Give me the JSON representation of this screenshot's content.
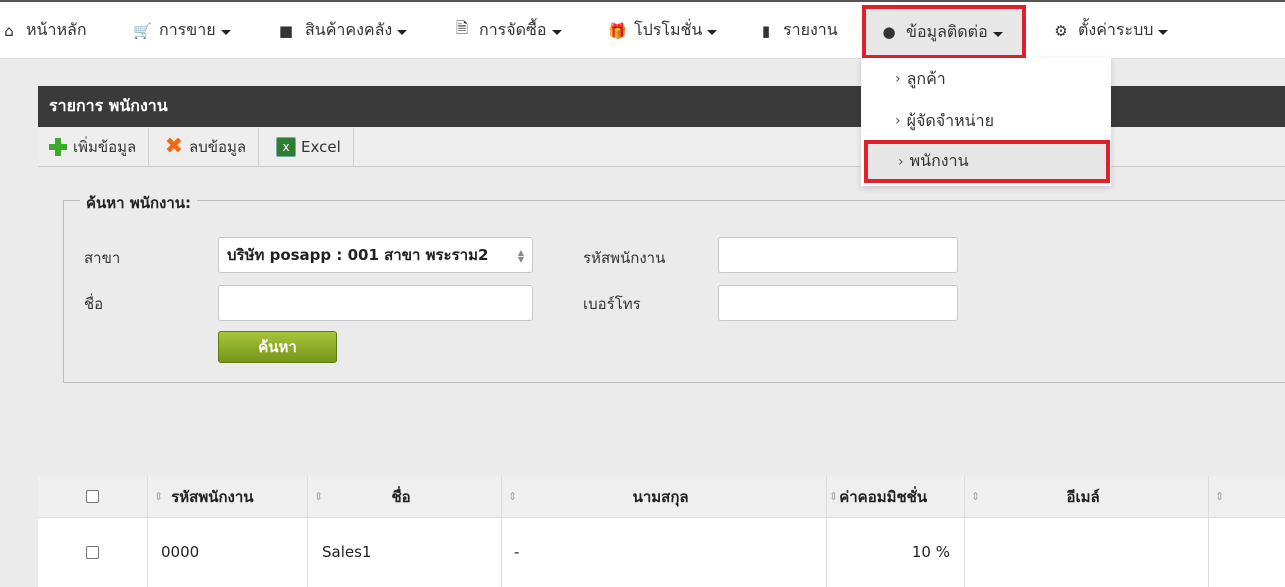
{
  "nav": {
    "home": "หน้าหลัก",
    "sales": "การขาย",
    "inventory": "สินค้าคงคลัง",
    "purchasing": "การจัดซื้อ",
    "promotion": "โปรโมชั่น",
    "reports": "รายงาน",
    "contacts": "ข้อมูลติดต่อ",
    "settings": "ตั้งค่าระบบ"
  },
  "dropdown": {
    "items": [
      "ลูกค้า",
      "ผู้จัดจำหน่าย",
      "พนักงาน"
    ]
  },
  "panel": {
    "title": "รายการ พนักงาน"
  },
  "toolbar": {
    "add": "เพิ่มข้อมูล",
    "delete": "ลบข้อมูล",
    "excel": "Excel"
  },
  "search": {
    "legend": "ค้นหา พนักงาน:",
    "branch_label": "สาขา",
    "branch_value": "บริษัท posapp : 001 สาขา พระราม2",
    "code_label": "รหัสพนักงาน",
    "code_value": "",
    "name_label": "ชื่อ",
    "name_value": "",
    "phone_label": "เบอร์โทร",
    "phone_value": "",
    "button": "ค้นหา"
  },
  "table": {
    "headers": [
      "รหัสพนักงาน",
      "ชื่อ",
      "นามสกุล",
      "ค่าคอมมิชชั่น",
      "อีเมล์"
    ],
    "rows": [
      {
        "code": "0000",
        "name": "Sales1",
        "surname": "-",
        "commission": "10 %",
        "email": ""
      }
    ]
  }
}
